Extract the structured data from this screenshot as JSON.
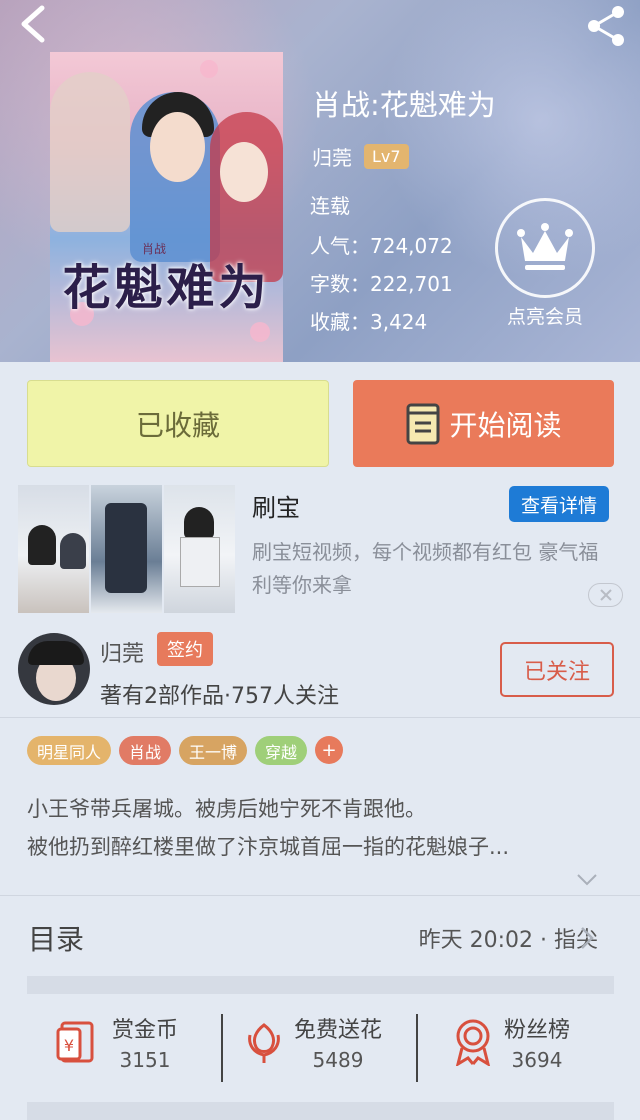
{
  "book": {
    "title": "肖战:花魁难为",
    "author": "归莞",
    "author_level": "Lv7",
    "status": "连载",
    "popularity_label": "人气",
    "popularity": "724,072",
    "words_label": "字数",
    "words": "222,701",
    "favorites_label": "收藏",
    "favorites": "3,424",
    "cover_title": "花魁难为",
    "cover_sub": "肖战"
  },
  "vip": {
    "label": "点亮会员",
    "icon": "crown-icon"
  },
  "actions": {
    "favorited_label": "已收藏",
    "read_label": "开始阅读"
  },
  "ad": {
    "title": "刷宝",
    "detail_label": "查看详情",
    "description": "刷宝短视频，每个视频都有红包 豪气福利等你来拿"
  },
  "author": {
    "name": "归莞",
    "badge": "签约",
    "works": "著有2部作品·757人关注",
    "follow_label": "已关注"
  },
  "tags": [
    {
      "label": "明星同人",
      "color": "#e4b46b"
    },
    {
      "label": "肖战",
      "color": "#e17b65"
    },
    {
      "label": "王一博",
      "color": "#d7a462"
    },
    {
      "label": "穿越",
      "color": "#9fcf79"
    }
  ],
  "tag_add": "+",
  "synopsis": {
    "line1": "小王爷带兵屠城。被虏后她宁死不肯跟他。",
    "line2": "被他扔到醉红楼里做了汴京城首屈一指的花魁娘子..."
  },
  "toc": {
    "title": "目录",
    "latest": "昨天 20:02 · 指尖"
  },
  "stats": [
    {
      "label": "赏金币",
      "value": "3151",
      "icon": "red-envelope-icon"
    },
    {
      "label": "免费送花",
      "value": "5489",
      "icon": "flower-icon"
    },
    {
      "label": "粉丝榜",
      "value": "3694",
      "icon": "medal-icon"
    }
  ],
  "colors": {
    "accent": "#ea7a5a",
    "favorite_bg": "#f0f4a8",
    "ad_button": "#1e7bd6",
    "page_bg": "#e3e9f2"
  }
}
